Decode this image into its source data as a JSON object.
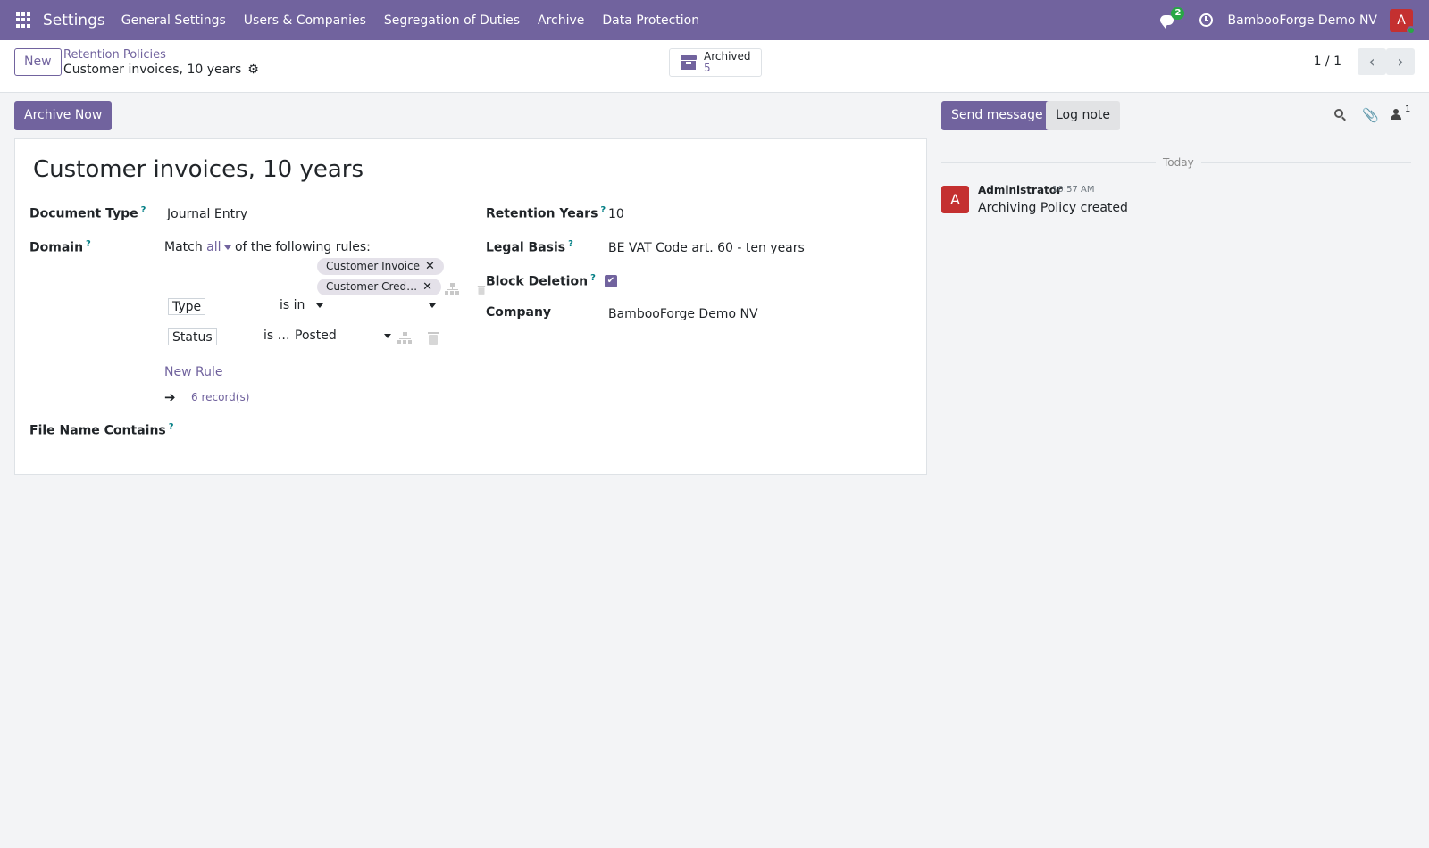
{
  "navbar": {
    "app_name": "Settings",
    "menu": [
      "General Settings",
      "Users & Companies",
      "Segregation of Duties",
      "Archive",
      "Data Protection"
    ],
    "messages_badge": "2",
    "company": "BambooForge Demo NV",
    "avatar_letter": "A",
    "brand_color": "#71639e"
  },
  "control_panel": {
    "new_label": "New",
    "breadcrumb": "Retention Policies",
    "record_title": "Customer invoices, 10 years",
    "stat_label": "Archived",
    "stat_value": "5",
    "pager": "1 / 1"
  },
  "form": {
    "archive_now_label": "Archive Now",
    "title": "Customer invoices, 10 years",
    "document_type_label": "Document Type",
    "document_type_value": "Journal Entry",
    "domain_label": "Domain",
    "domain_match_prefix": "Match",
    "domain_match_mode": "all",
    "domain_match_suffix": "of the following rules:",
    "rule1_field": "Type",
    "rule1_operator": "is in",
    "rule1_tags": [
      "Customer Invoice",
      "Customer Cred…"
    ],
    "rule2_field": "Status",
    "rule2_operator": "is …",
    "rule2_value": "Posted",
    "new_rule_label": "New Rule",
    "records_link": "6 record(s)",
    "file_name_label": "File Name Contains",
    "retention_years_label": "Retention Years",
    "retention_years_value": "10",
    "legal_basis_label": "Legal Basis",
    "legal_basis_value": "BE VAT Code art. 60 - ten years",
    "block_deletion_label": "Block Deletion",
    "block_deletion_checked": true,
    "company_label": "Company",
    "company_value": "BambooForge Demo NV",
    "help_mark": "?"
  },
  "chatter": {
    "send_message_label": "Send message",
    "log_note_label": "Log note",
    "follower_count": "1",
    "date_separator": "Today",
    "message": {
      "avatar_letter": "A",
      "author": "Administrator",
      "time": "10:57 AM",
      "body": "Archiving Policy created"
    }
  }
}
